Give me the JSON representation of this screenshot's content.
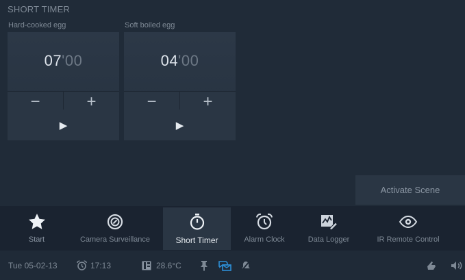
{
  "page": {
    "title": "SHORT TIMER"
  },
  "timers": [
    {
      "label": "Hard-cooked egg",
      "minutes": "07",
      "separator": "'",
      "seconds": "00",
      "minus": "−",
      "plus": "+",
      "play": "▶"
    },
    {
      "label": "Soft boiled egg",
      "minutes": "04",
      "separator": "'",
      "seconds": "00",
      "minus": "−",
      "plus": "+",
      "play": "▶"
    }
  ],
  "scene_button": "Activate Scene",
  "nav": {
    "items": [
      {
        "label": "Start",
        "icon": "star-icon"
      },
      {
        "label": "Camera Surveillance",
        "icon": "camera-lens-icon"
      },
      {
        "label": "Short Timer",
        "icon": "stopwatch-icon",
        "active": true
      },
      {
        "label": "Alarm Clock",
        "icon": "alarm-clock-icon"
      },
      {
        "label": "Data Logger",
        "icon": "data-logger-icon"
      },
      {
        "label": "IR Remote Control",
        "icon": "eye-icon"
      }
    ]
  },
  "status": {
    "date": "Tue 05-02-13",
    "time": "17:13",
    "temperature": "28.6°C"
  },
  "colors": {
    "background": "#202b38",
    "panel": "#2a3644",
    "nav_bar": "#1a2330",
    "accent_blue": "#2d8fd6",
    "text_dim": "#7e8995",
    "text_bright": "#e6ebf0"
  }
}
